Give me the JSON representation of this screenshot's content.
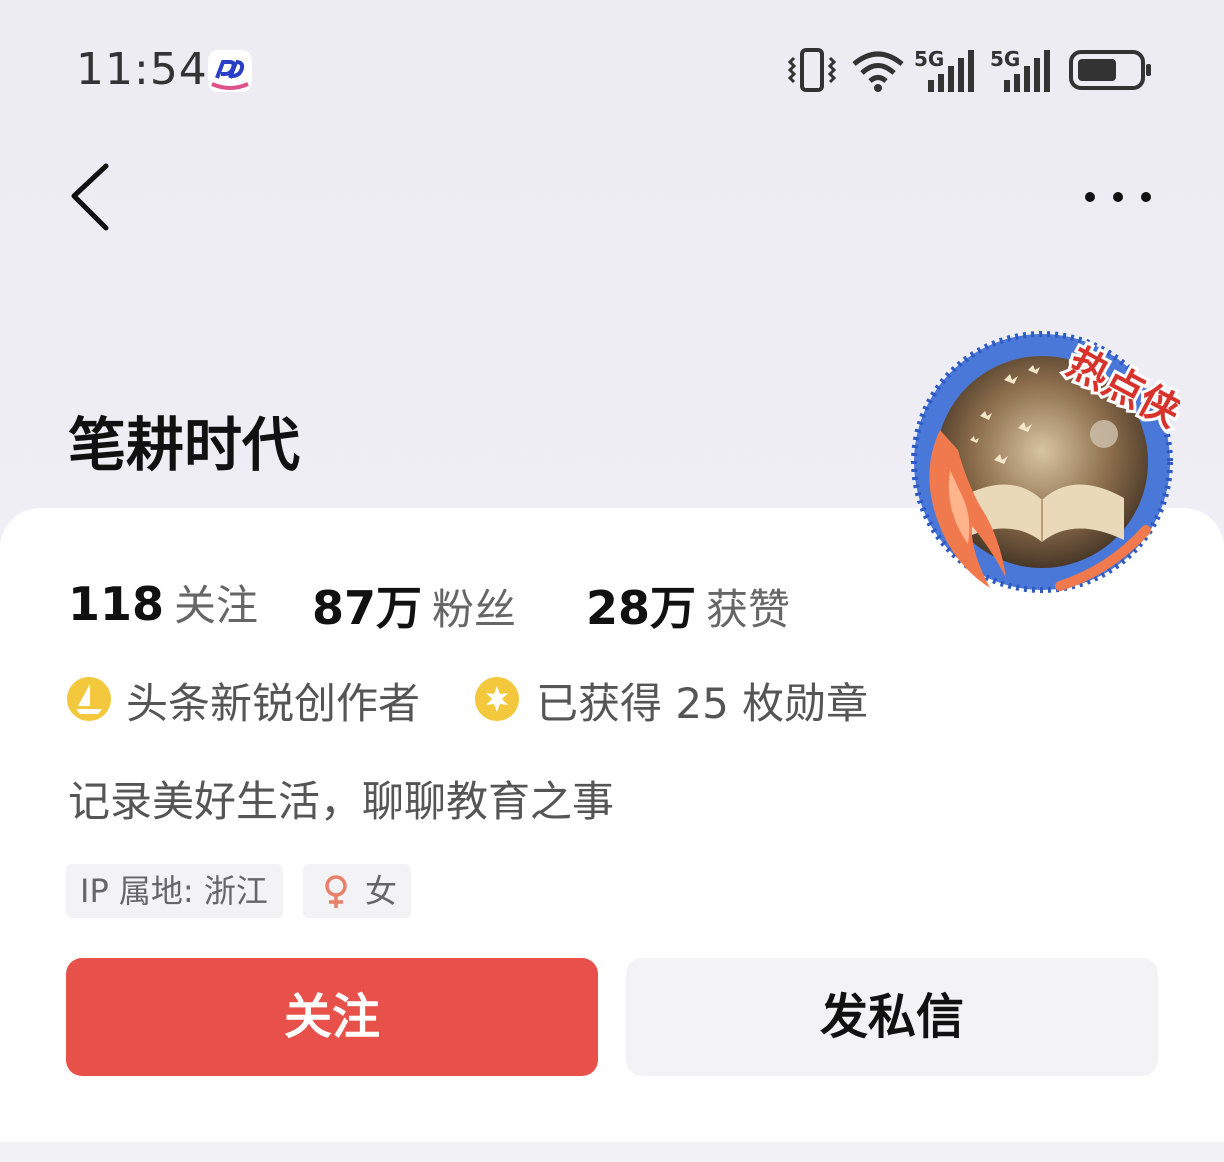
{
  "status_bar": {
    "time": "11:54",
    "signal_1_label": "5G",
    "signal_2_label": "5G"
  },
  "header": {
    "back_icon": "chevron-left-icon",
    "more_icon": "more-dots-icon"
  },
  "profile": {
    "username": "笔耕时代",
    "avatar_badge": "热点侠",
    "stats": [
      {
        "value": "118",
        "unit": "",
        "label": "关注"
      },
      {
        "value": "87",
        "unit": "万",
        "label": "粉丝"
      },
      {
        "value": "28",
        "unit": "万",
        "label": "获赞"
      }
    ],
    "badges": [
      {
        "icon": "sailboat-icon",
        "text": "头条新锐创作者"
      },
      {
        "icon": "medal-icon",
        "text": "已获得 25 枚勋章"
      }
    ],
    "bio": "记录美好生活，聊聊教育之事",
    "tags": {
      "ip": "IP 属地: 浙江",
      "gender": "女"
    }
  },
  "actions": {
    "follow_label": "关注",
    "message_label": "发私信"
  },
  "colors": {
    "accent": "#e8504a",
    "badge_gold": "#f3c83c"
  }
}
